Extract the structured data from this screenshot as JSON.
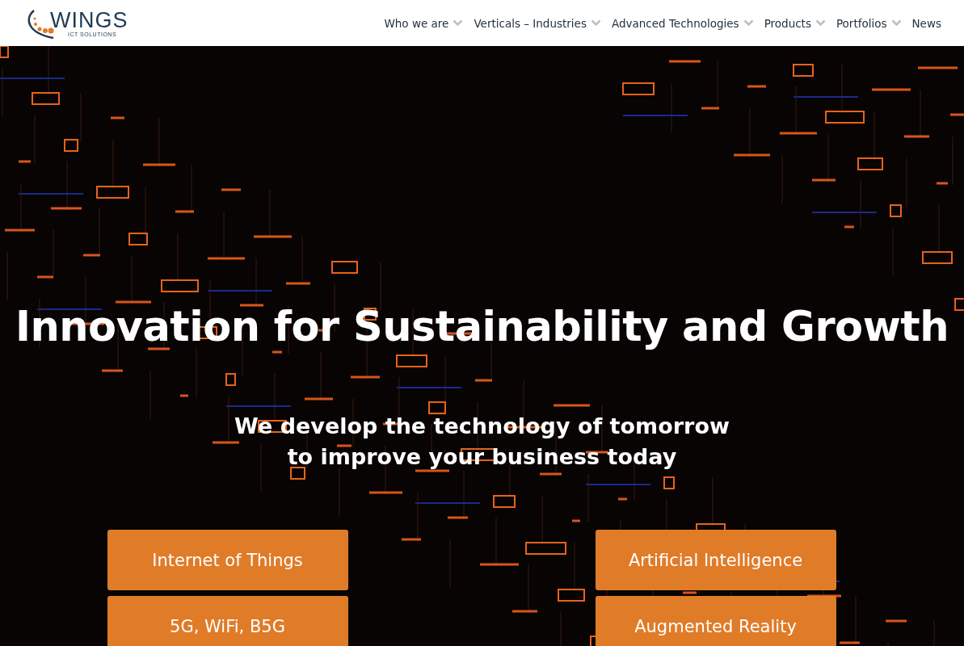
{
  "logo": {
    "name": "WINGS",
    "tagline": "ICT SOLUTIONS"
  },
  "nav": [
    {
      "label": "Who we are",
      "dropdown": true
    },
    {
      "label": "Verticals – Industries",
      "dropdown": true
    },
    {
      "label": "Advanced Technologies",
      "dropdown": true
    },
    {
      "label": "Products",
      "dropdown": true
    },
    {
      "label": "Portfolios",
      "dropdown": true
    },
    {
      "label": "News",
      "dropdown": false
    }
  ],
  "hero": {
    "title": "Innovation for Sustainability and Growth",
    "subtitle": "We develop the technology of tomorrow\nto improve your business today",
    "buttons": [
      {
        "label": "Internet of Things"
      },
      {
        "label": "Artificial Intelligence"
      },
      {
        "label": "5G, WiFi, B5G"
      },
      {
        "label": "Augmented Reality"
      }
    ]
  }
}
